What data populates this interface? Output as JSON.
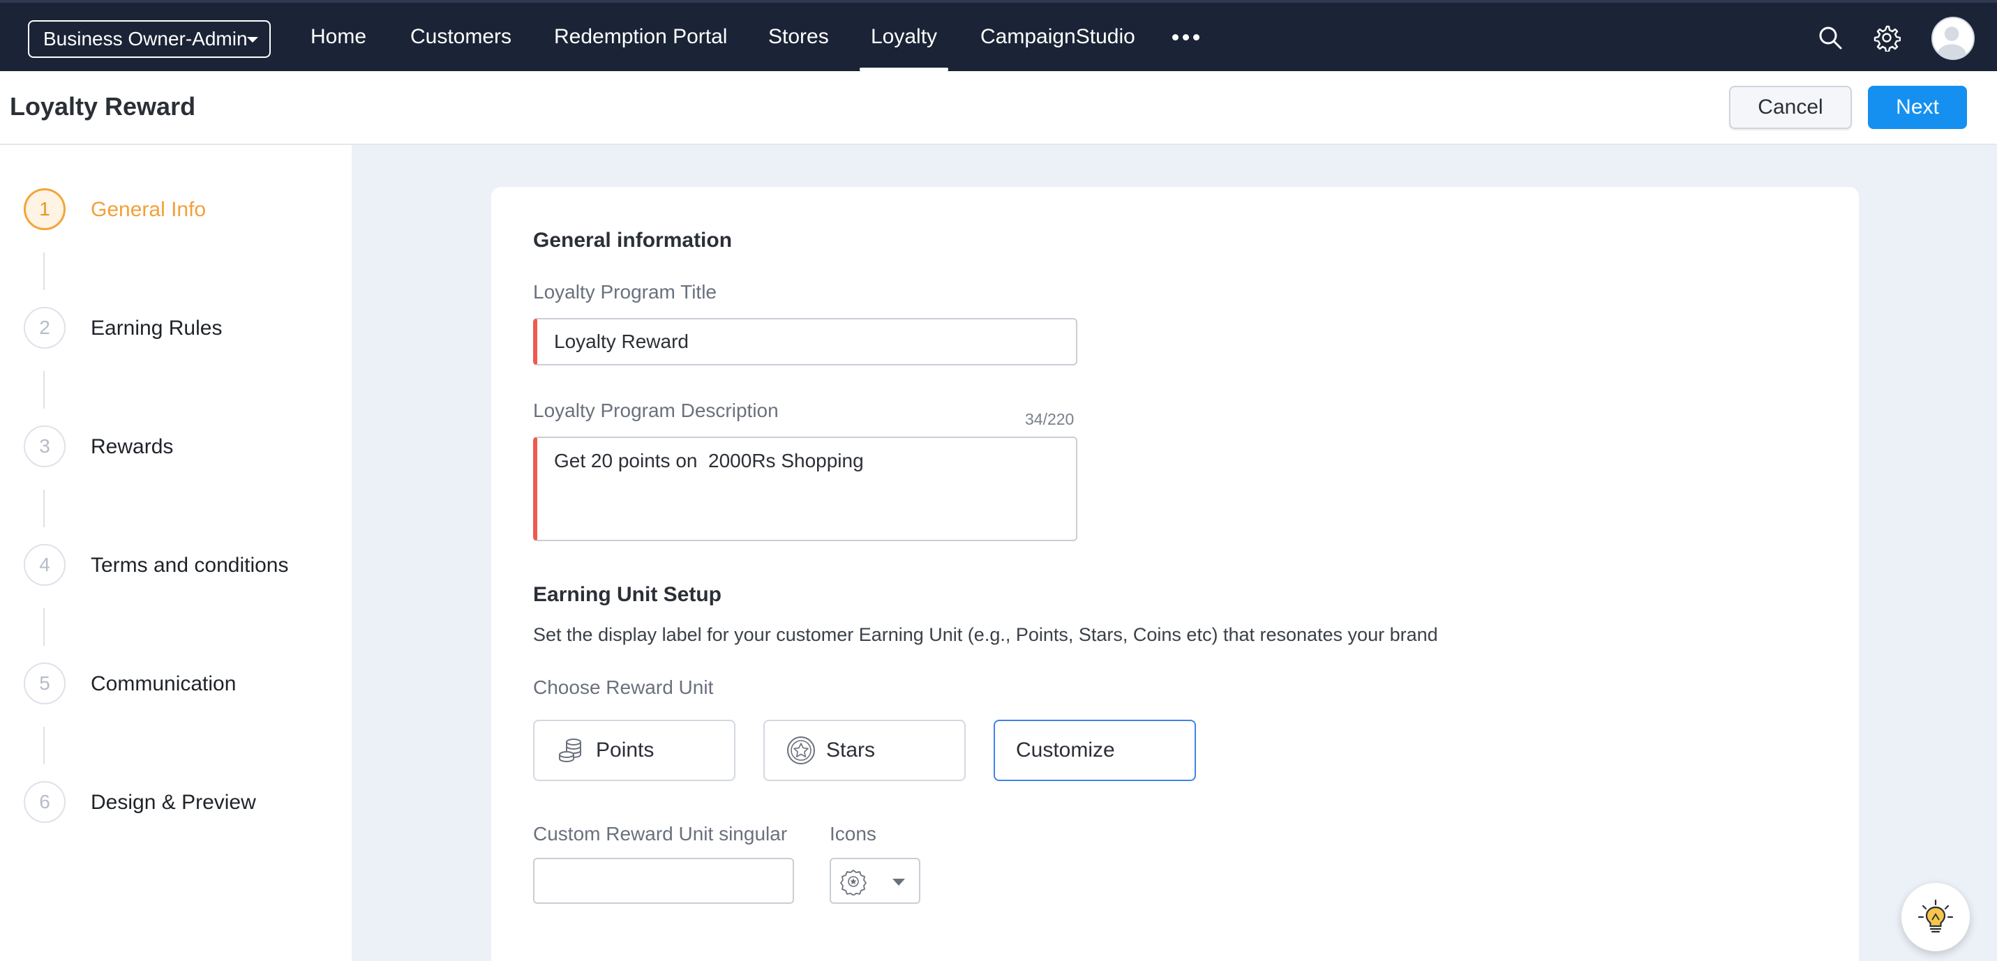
{
  "topnav": {
    "org_selector": "Business Owner-Admin",
    "items": [
      {
        "label": "Home",
        "active": false
      },
      {
        "label": "Customers",
        "active": false
      },
      {
        "label": "Redemption Portal",
        "active": false
      },
      {
        "label": "Stores",
        "active": false
      },
      {
        "label": "Loyalty",
        "active": true
      },
      {
        "label": "CampaignStudio",
        "active": false
      }
    ],
    "more_icon": "more-horizontal-icon",
    "search_icon": "search-icon",
    "settings_icon": "gear-icon",
    "avatar_icon": "user-avatar-icon"
  },
  "header": {
    "title": "Loyalty Reward",
    "cancel_label": "Cancel",
    "next_label": "Next"
  },
  "steps": [
    {
      "number": "1",
      "label": "General Info",
      "active": true
    },
    {
      "number": "2",
      "label": "Earning Rules",
      "active": false
    },
    {
      "number": "3",
      "label": "Rewards",
      "active": false
    },
    {
      "number": "4",
      "label": "Terms and conditions",
      "active": false
    },
    {
      "number": "5",
      "label": "Communication",
      "active": false
    },
    {
      "number": "6",
      "label": "Design & Preview",
      "active": false
    }
  ],
  "general": {
    "section_title": "General information",
    "title_label": "Loyalty Program Title",
    "title_value": "Loyalty Reward",
    "description_label": "Loyalty Program Description",
    "description_counter": "34/220",
    "description_value": "Get 20 points on  2000Rs Shopping"
  },
  "earning_unit": {
    "section_title": "Earning Unit Setup",
    "helper": "Set the display label for your customer Earning Unit (e.g., Points, Stars, Coins etc) that resonates your brand",
    "choose_label": "Choose Reward Unit",
    "options": [
      {
        "label": "Points",
        "icon": "coins-icon",
        "selected": false
      },
      {
        "label": "Stars",
        "icon": "star-badge-icon",
        "selected": false
      },
      {
        "label": "Customize",
        "icon": "",
        "selected": true
      }
    ],
    "custom_singular_label": "Custom Reward Unit singular",
    "custom_singular_value": "",
    "icons_label": "Icons",
    "icons_selected": "badge-icon"
  },
  "fab": {
    "icon": "lightbulb-icon"
  },
  "colors": {
    "nav_bg": "#1b2436",
    "accent_blue": "#1590f0",
    "active_step": "#f2a03a",
    "required_marker": "#ef5a4e",
    "content_bg": "#ecf0f7"
  }
}
